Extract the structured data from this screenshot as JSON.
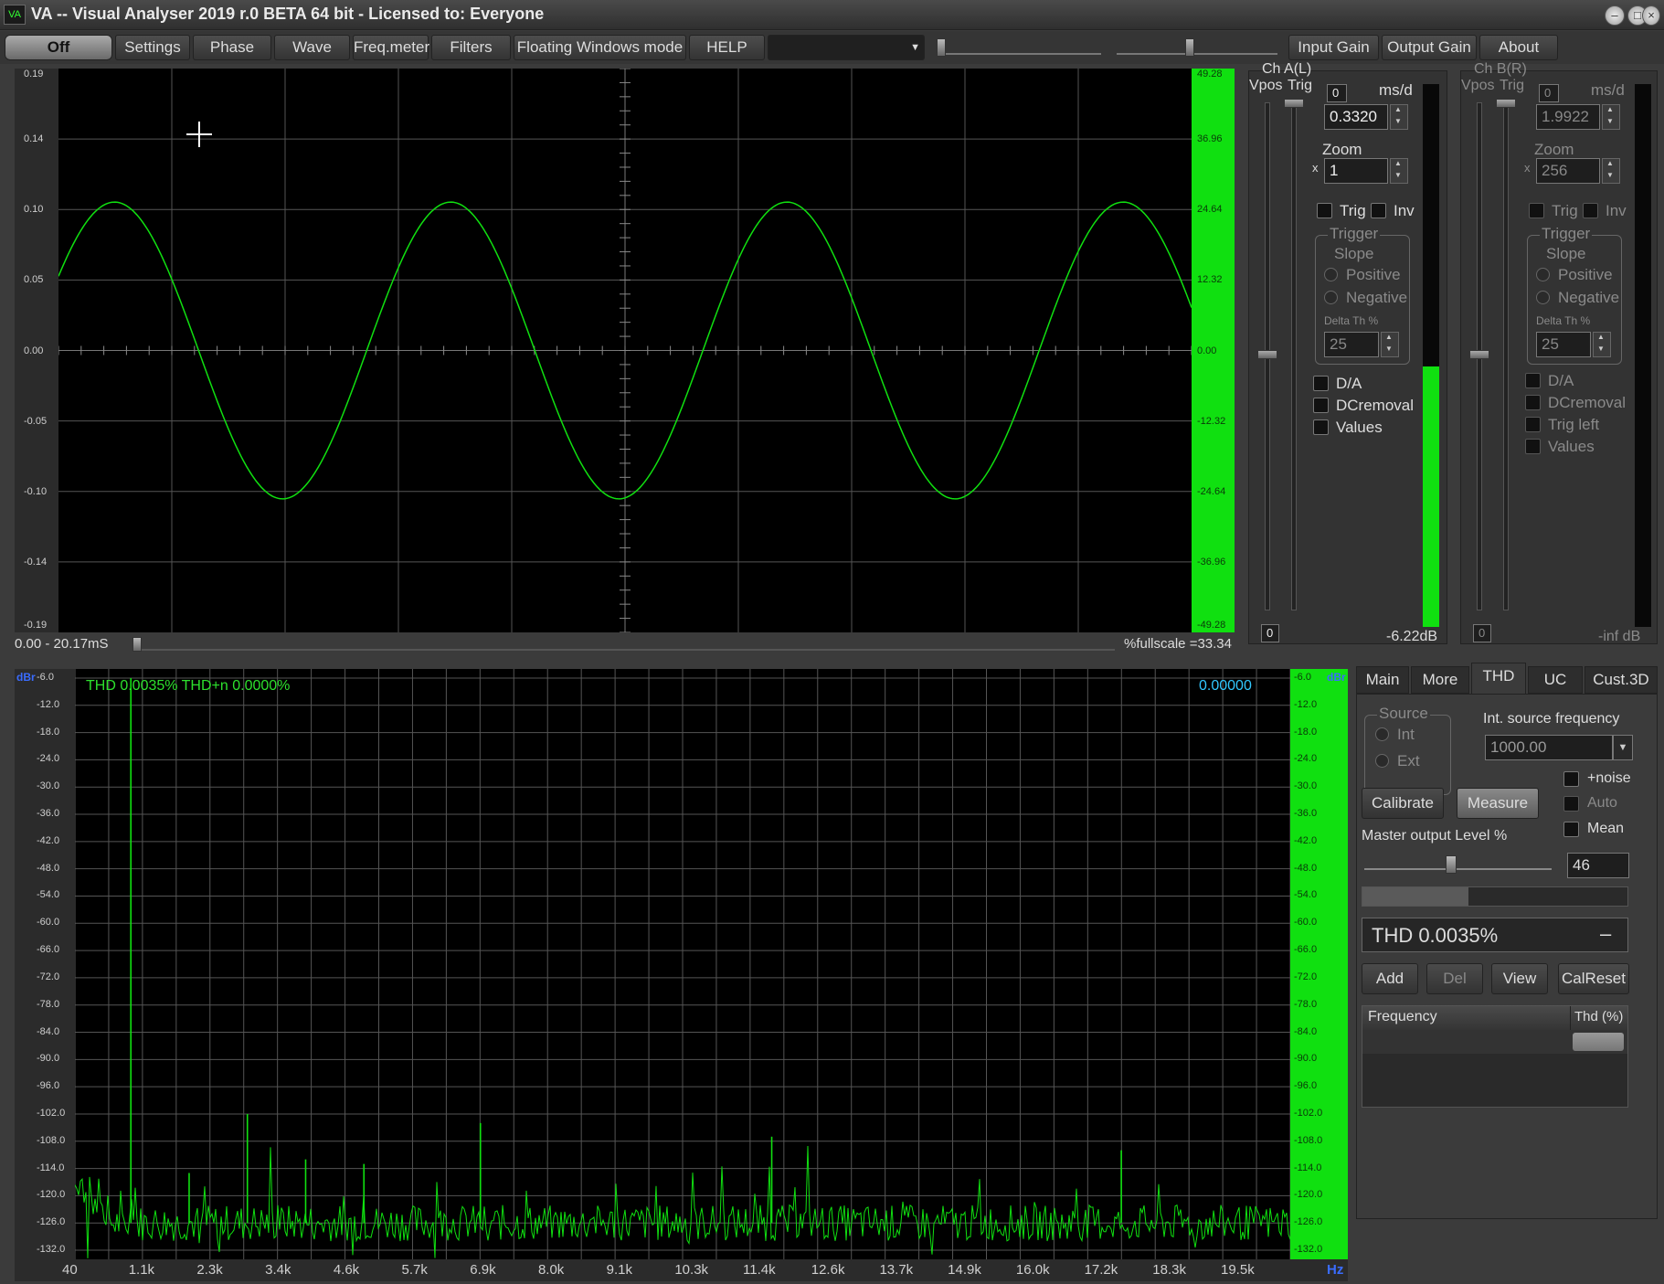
{
  "window": {
    "title": "VA -- Visual Analyser 2019 r.0 BETA 64 bit - Licensed to: Everyone",
    "logo_text": "VA",
    "minimize": "–",
    "maximize": "□",
    "close": "×"
  },
  "toolbar": {
    "off": "Off",
    "settings": "Settings",
    "phase": "Phase",
    "wave": "Wave",
    "freqmeter": "Freq.meter",
    "filters": "Filters",
    "floating": "Floating Windows mode",
    "help": "HELP",
    "dropdown_value": "",
    "input_gain": "Input Gain",
    "output_gain": "Output Gain",
    "about": "About"
  },
  "scope": {
    "y_left": [
      "0.19",
      "0.14",
      "0.10",
      "0.05",
      "0.00",
      "-0.05",
      "-0.10",
      "-0.14",
      "-0.19"
    ],
    "y_right": [
      "49.28",
      "36.96",
      "24.64",
      "12.32",
      "0.00",
      "-12.32",
      "-24.64",
      "-36.96",
      "-49.28"
    ],
    "time_range": "0.00 - 20.17mS",
    "fullscale": "%fullscale =33.34",
    "wave": {
      "amplitude": 0.1,
      "cycles": 3.37,
      "phase_deg": 30,
      "color": "#10e010"
    }
  },
  "cha": {
    "title": "Ch A(L)",
    "vpos": "Vpos",
    "trig": "Trig",
    "zero_val": "0",
    "msd_label": "ms/d",
    "msd_value": "0.3320",
    "zoom_label": "Zoom",
    "zoom_x": "x",
    "zoom_value": "1",
    "trig_chk": "Trig",
    "inv_chk": "Inv",
    "trigger_group": "Trigger",
    "slope": "Slope",
    "positive": "Positive",
    "negative": "Negative",
    "delta_label": "Delta Th %",
    "delta_value": "25",
    "da": "D/A",
    "dcremoval": "DCremoval",
    "values": "Values",
    "bottom_zero": "0",
    "level": "-6.22dB",
    "level_fraction": 0.48
  },
  "chb": {
    "title": "Ch B(R)",
    "vpos": "Vpos",
    "trig": "Trig",
    "zero_val": "0",
    "msd_label": "ms/d",
    "msd_value": "1.9922",
    "zoom_label": "Zoom",
    "zoom_x": "x",
    "zoom_value": "256",
    "trig_chk": "Trig",
    "inv_chk": "Inv",
    "trigger_group": "Trigger",
    "slope": "Slope",
    "positive": "Positive",
    "negative": "Negative",
    "delta_label": "Delta Th %",
    "delta_value": "25",
    "da": "D/A",
    "dcremoval": "DCremoval",
    "trigleft": "Trig left",
    "values": "Values",
    "bottom_zero": "0",
    "level": "-inf dB"
  },
  "spectrum": {
    "unit": "dBr",
    "thd_text": "THD 0.0035% THD+n 0.0000%",
    "value_readout": "0.00000",
    "y_labels": [
      "-6.0",
      "-12.0",
      "-18.0",
      "-24.0",
      "-30.0",
      "-36.0",
      "-42.0",
      "-48.0",
      "-54.0",
      "-60.0",
      "-66.0",
      "-72.0",
      "-78.0",
      "-84.0",
      "-90.0",
      "-96.0",
      "-102.0",
      "-108.0",
      "-114.0",
      "-120.0",
      "-126.0",
      "-132.0"
    ],
    "x_labels": [
      "40",
      "1.1k",
      "2.3k",
      "3.4k",
      "4.6k",
      "5.7k",
      "6.9k",
      "8.0k",
      "9.1k",
      "10.3k",
      "11.4k",
      "12.6k",
      "13.7k",
      "14.9k",
      "16.0k",
      "17.2k",
      "18.3k",
      "19.5k"
    ],
    "x_unit": "Hz",
    "x_range": [
      40,
      20900
    ],
    "y_range": [
      -132,
      -6
    ],
    "noise_floor": -126,
    "peaks": [
      {
        "f": 1000,
        "db": -6
      },
      {
        "f": 2000,
        "db": -115
      },
      {
        "f": 3000,
        "db": -102
      },
      {
        "f": 4000,
        "db": -112
      },
      {
        "f": 5000,
        "db": -113
      },
      {
        "f": 7000,
        "db": -104
      },
      {
        "f": 12000,
        "db": -107
      },
      {
        "f": 18000,
        "db": -110
      }
    ]
  },
  "tabs": {
    "main": "Main",
    "more": "More",
    "thd": "THD",
    "uc": "UC",
    "cust3d": "Cust.3D"
  },
  "thd": {
    "source": "Source",
    "int": "Int",
    "ext": "Ext",
    "int_freq_label": "Int. source frequency",
    "int_freq_value": "1000.00",
    "noise": "+noise",
    "auto": "Auto",
    "mean": "Mean",
    "calibrate": "Calibrate",
    "measure": "Measure",
    "master_label": "Master output Level %",
    "master_value": "46",
    "master_fraction": 0.46,
    "thd_display": "THD 0.0035%",
    "thd_dash": "–",
    "add": "Add",
    "del": "Del",
    "view": "View",
    "calreset": "CalReset",
    "col_freq": "Frequency",
    "col_thd": "Thd (%)",
    "progress_fraction": 0.4
  }
}
